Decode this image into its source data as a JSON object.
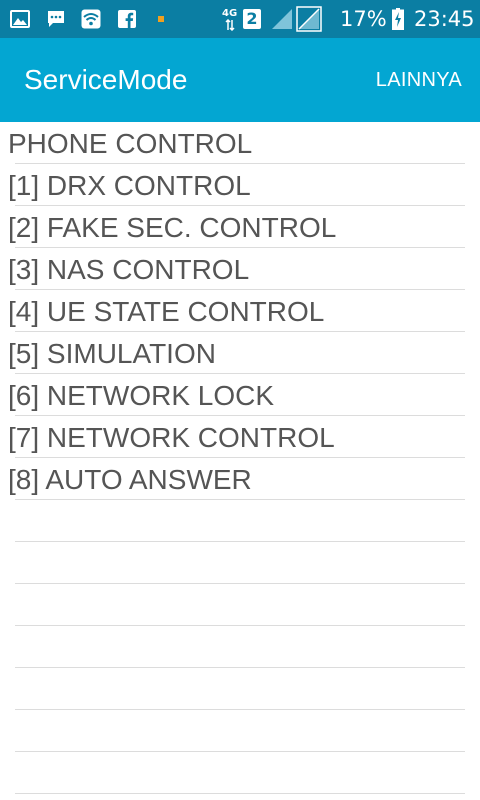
{
  "status_bar": {
    "network_label": "4G",
    "sim_slot": "2",
    "battery_percent": "17%",
    "clock": "23:45",
    "icons": [
      "gallery-icon",
      "chat-icon",
      "wifi-icon",
      "facebook-icon",
      "notification-dot-icon",
      "sim-2-icon",
      "signal-icon",
      "signal-empty-icon",
      "battery-charging-icon"
    ]
  },
  "action_bar": {
    "title": "ServiceMode",
    "overflow_label": "LAINNYA"
  },
  "menu": {
    "items": [
      {
        "label": "PHONE CONTROL"
      },
      {
        "label": "[1] DRX CONTROL"
      },
      {
        "label": "[2] FAKE SEC. CONTROL"
      },
      {
        "label": "[3] NAS CONTROL"
      },
      {
        "label": "[4] UE STATE CONTROL"
      },
      {
        "label": "[5] SIMULATION"
      },
      {
        "label": "[6] NETWORK LOCK"
      },
      {
        "label": "[7] NETWORK CONTROL"
      },
      {
        "label": "[8] AUTO ANSWER"
      },
      {
        "label": ""
      },
      {
        "label": ""
      },
      {
        "label": ""
      },
      {
        "label": ""
      },
      {
        "label": ""
      },
      {
        "label": ""
      },
      {
        "label": ""
      }
    ]
  },
  "colors": {
    "status_bar": "#0b7ea3",
    "action_bar": "#03a6d2",
    "row_text": "#555555",
    "divider": "#dcdcdc",
    "notification_dot": "#f0a020"
  }
}
